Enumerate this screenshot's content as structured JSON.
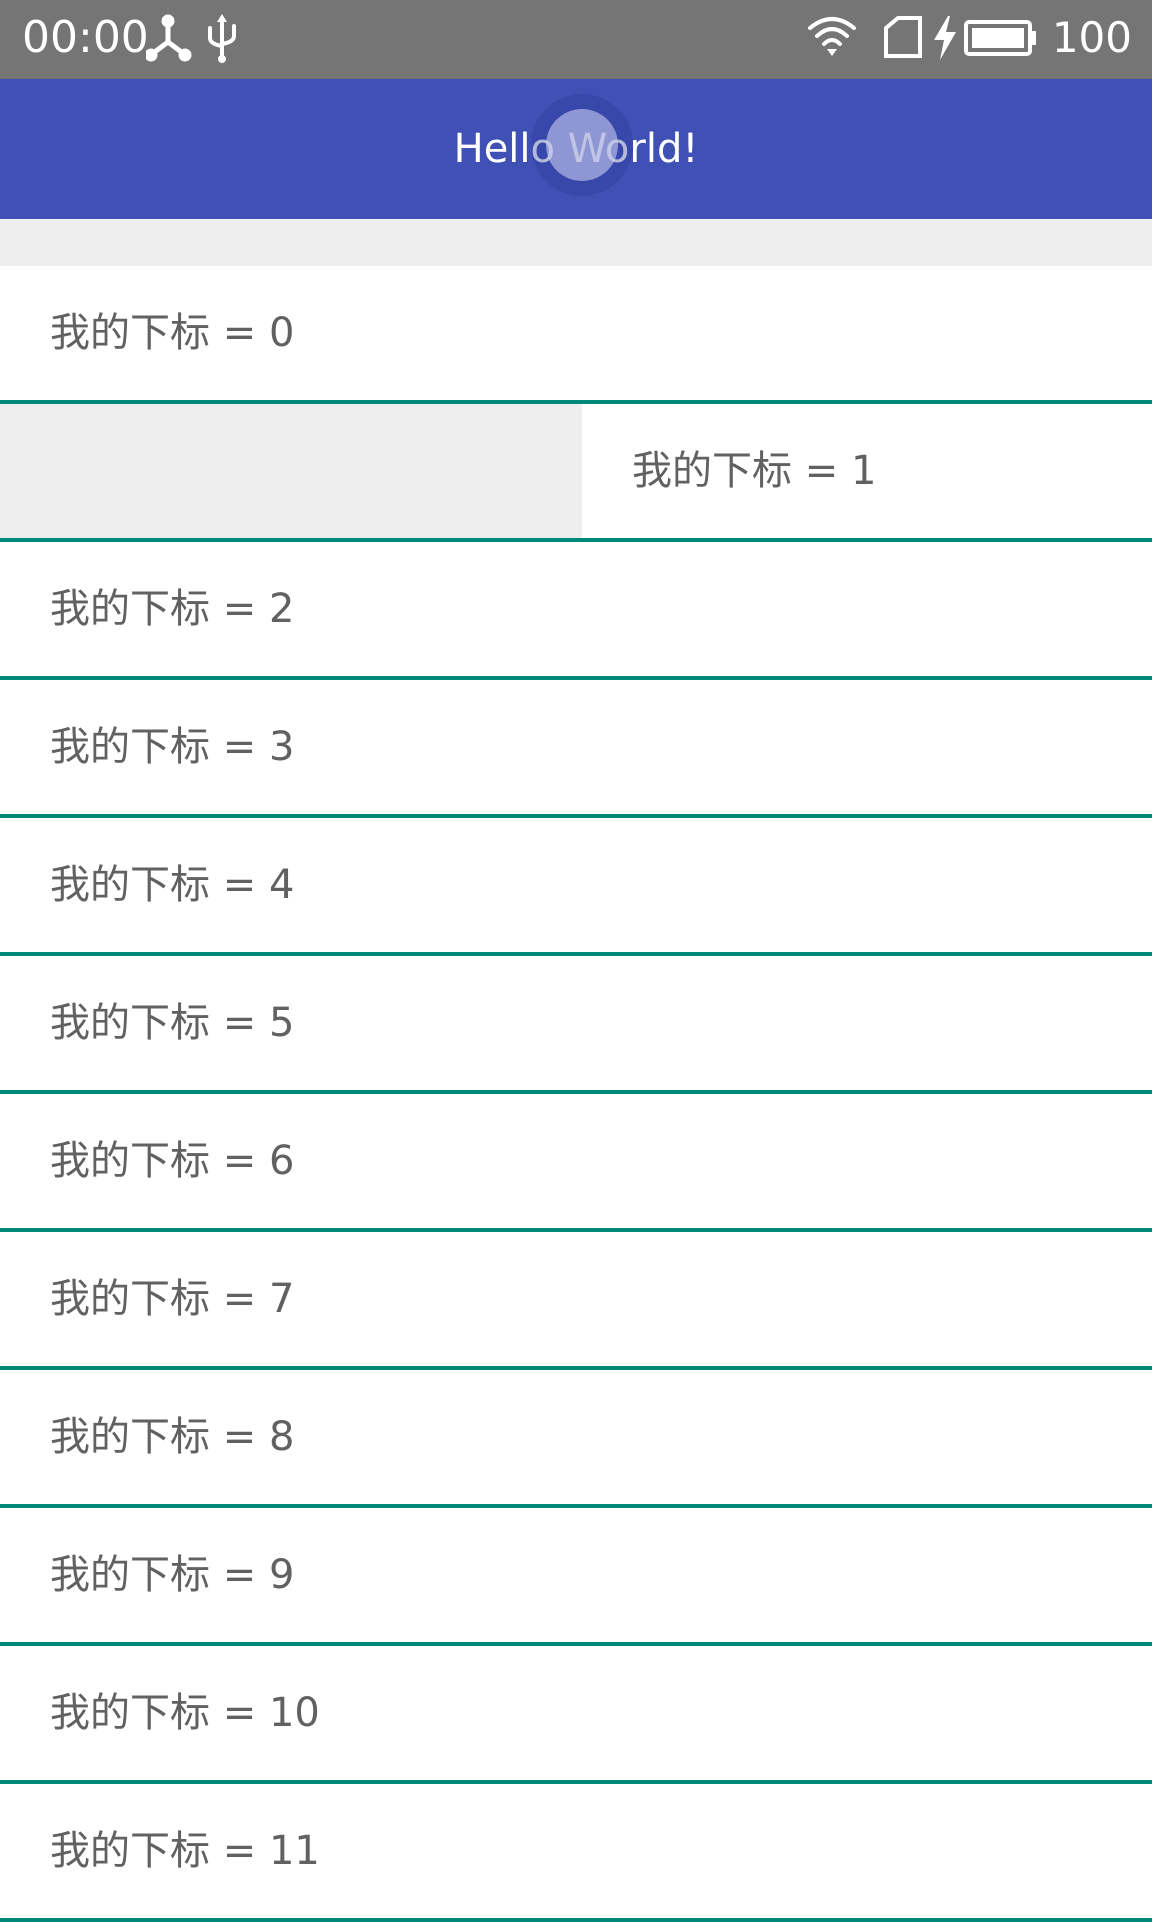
{
  "status_bar": {
    "time": "00:00",
    "left_icons": [
      "network-hub-icon",
      "usb-icon"
    ],
    "right_icons": [
      "wifi-icon",
      "sim-card-icon",
      "charging-bolt-icon",
      "battery-icon"
    ],
    "battery_level": "100"
  },
  "app_bar": {
    "title": "Hello World!",
    "color": "#3f51b5"
  },
  "list": {
    "divider_color": "#00897b",
    "items": [
      {
        "label": "我的下标 = 0"
      },
      {
        "label": "我的下标 = 1",
        "swiped": true
      },
      {
        "label": "我的下标 = 2"
      },
      {
        "label": "我的下标 = 3"
      },
      {
        "label": "我的下标 = 4"
      },
      {
        "label": "我的下标 = 5"
      },
      {
        "label": "我的下标 = 6"
      },
      {
        "label": "我的下标 = 7"
      },
      {
        "label": "我的下标 = 8"
      },
      {
        "label": "我的下标 = 9"
      },
      {
        "label": "我的下标 = 10"
      },
      {
        "label": "我的下标 = 11"
      }
    ]
  }
}
